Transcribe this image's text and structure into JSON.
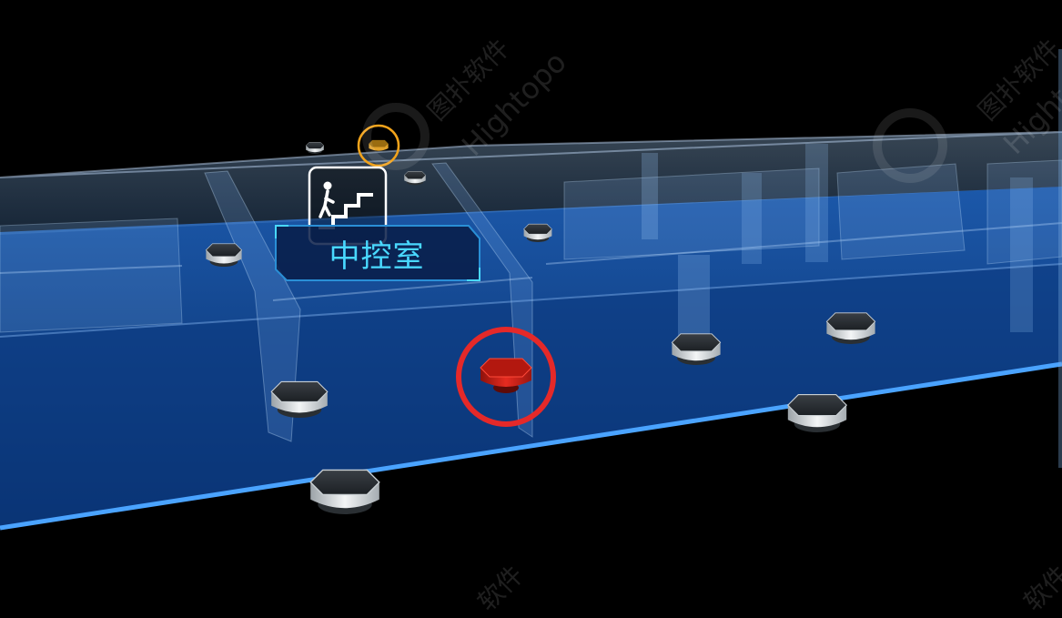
{
  "room_label": "中控室",
  "watermarks": [
    "图扑软件",
    "Hightopo",
    "图扑软件",
    "Hightopo",
    "软件",
    "软件"
  ],
  "colors": {
    "background": "#000000",
    "floor_glass": "#0c3f86",
    "floor_edge": "#4aa3ff",
    "label_text": "#49d8ff",
    "alarm_ring": "#e52929",
    "alarm_device": "#d4231b",
    "warning_ring": "#f2a31b",
    "warning_device": "#e0a12a",
    "device_body": "#d8dcdf"
  },
  "icons": {
    "stairs": "stairs-person-icon",
    "device": "smoke-detector-icon"
  }
}
